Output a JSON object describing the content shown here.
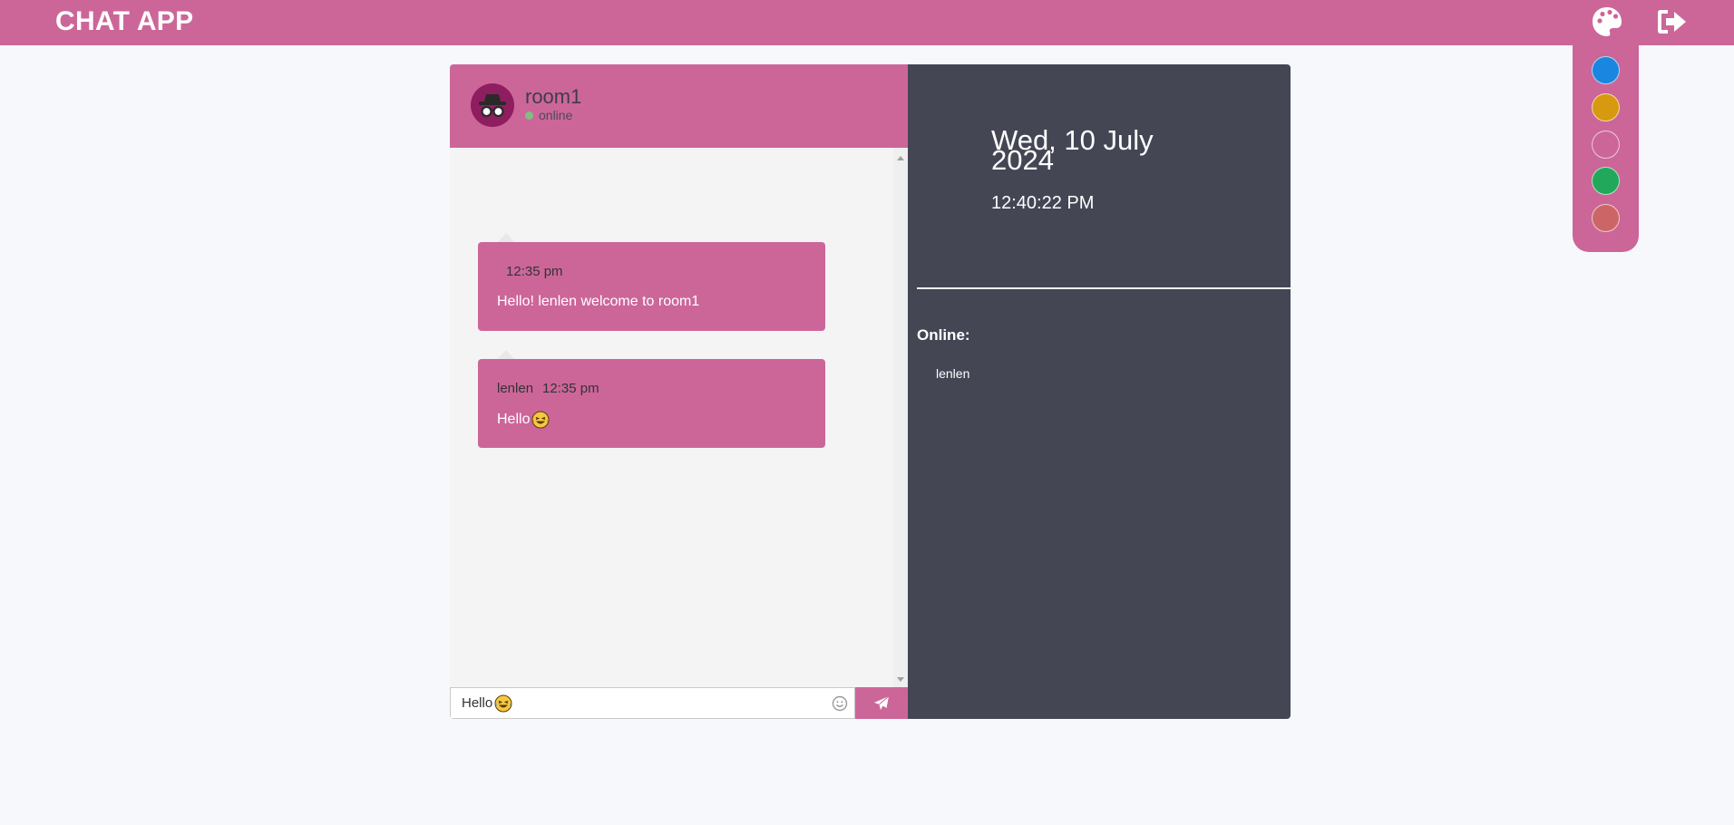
{
  "app": {
    "title": "CHAT APP"
  },
  "theme": {
    "accent": "#cc6699",
    "swatches": [
      {
        "name": "blue",
        "color": "#1a86e0"
      },
      {
        "name": "gold",
        "color": "#d6990f"
      },
      {
        "name": "pink",
        "color": "#cc6699"
      },
      {
        "name": "green",
        "color": "#22a85a"
      },
      {
        "name": "red",
        "color": "#cc6666"
      }
    ]
  },
  "icons": {
    "palette": "palette-icon",
    "logout": "sign-out-icon",
    "send": "paper-plane-icon",
    "emoji": "smiley-icon",
    "avatar": "incognito-icon"
  },
  "room": {
    "name": "room1",
    "status": "online"
  },
  "messages": [
    {
      "sender": "",
      "time": "12:35 pm",
      "text": "Hello! lenlen welcome to room1",
      "emoji": ""
    },
    {
      "sender": "lenlen",
      "time": "12:35 pm",
      "text": "Hello",
      "emoji": "laughing-tears"
    }
  ],
  "composer": {
    "value": "Hello",
    "emoji": "laughing-tears"
  },
  "sidebar": {
    "date": "Wed, 10 July 2024",
    "time": "12:40:22 PM",
    "online_label": "Online:",
    "online_users": [
      "lenlen"
    ]
  }
}
